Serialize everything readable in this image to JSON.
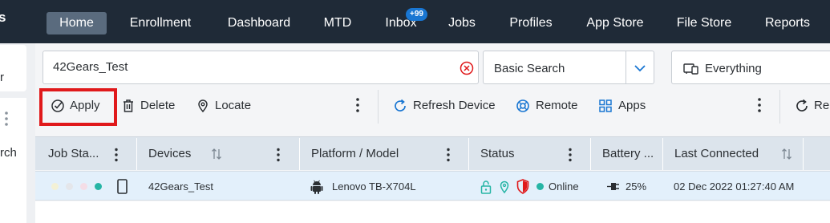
{
  "nav": {
    "brand_fragment": "s",
    "items": [
      {
        "label": "Home",
        "active": true
      },
      {
        "label": "Enrollment"
      },
      {
        "label": "Dashboard"
      },
      {
        "label": "MTD"
      },
      {
        "label": "Inbox",
        "badge": "+99"
      },
      {
        "label": "Jobs"
      },
      {
        "label": "Profiles"
      },
      {
        "label": "App Store"
      },
      {
        "label": "File Store"
      },
      {
        "label": "Reports"
      }
    ]
  },
  "sidebar": {
    "fragment_top": "r",
    "fragment_bottom": "rch"
  },
  "search": {
    "value": "42Gears_Test",
    "type": "Basic Search",
    "scope": "Everything"
  },
  "toolbar": {
    "apply": "Apply",
    "delete": "Delete",
    "locate": "Locate",
    "refresh_device": "Refresh Device",
    "remote": "Remote",
    "apps": "Apps",
    "refresh_fragment": "Re"
  },
  "table": {
    "columns": [
      "Job Sta...",
      "Devices",
      "Platform / Model",
      "Status",
      "Battery ...",
      "Last Connected"
    ],
    "rows": [
      {
        "device": "42Gears_Test",
        "model": "Lenovo TB-X704L",
        "status": "Online",
        "battery": "25%",
        "last_connected": "02 Dec 2022 01:27:40 AM"
      }
    ]
  },
  "colors": {
    "nav_bg": "#1f2a37",
    "accent": "#1976d2",
    "highlight_box": "#e0191b",
    "online": "#26b5a5",
    "row_selected": "#e3f0fb"
  }
}
